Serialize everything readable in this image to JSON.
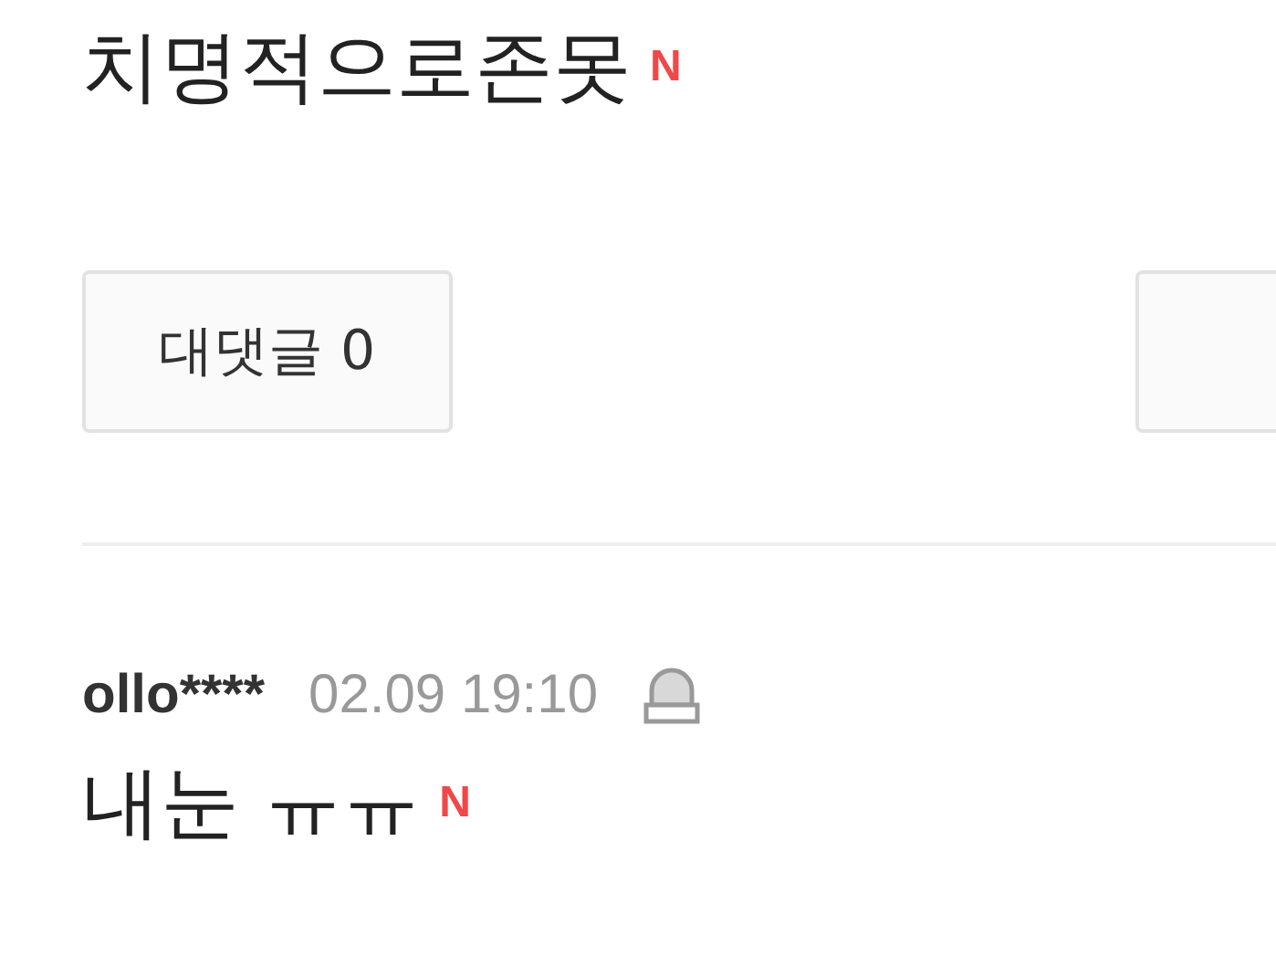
{
  "comments": [
    {
      "text": "치명적으로존못",
      "new_badge": "N",
      "buttons": [
        {
          "kind": "reply",
          "label": "대댓글 0"
        },
        {
          "kind": "partial"
        }
      ]
    },
    {
      "author": "ollo****",
      "time": "02.09 19:10",
      "text": "내눈 ㅠㅠ",
      "new_badge": "N"
    }
  ]
}
